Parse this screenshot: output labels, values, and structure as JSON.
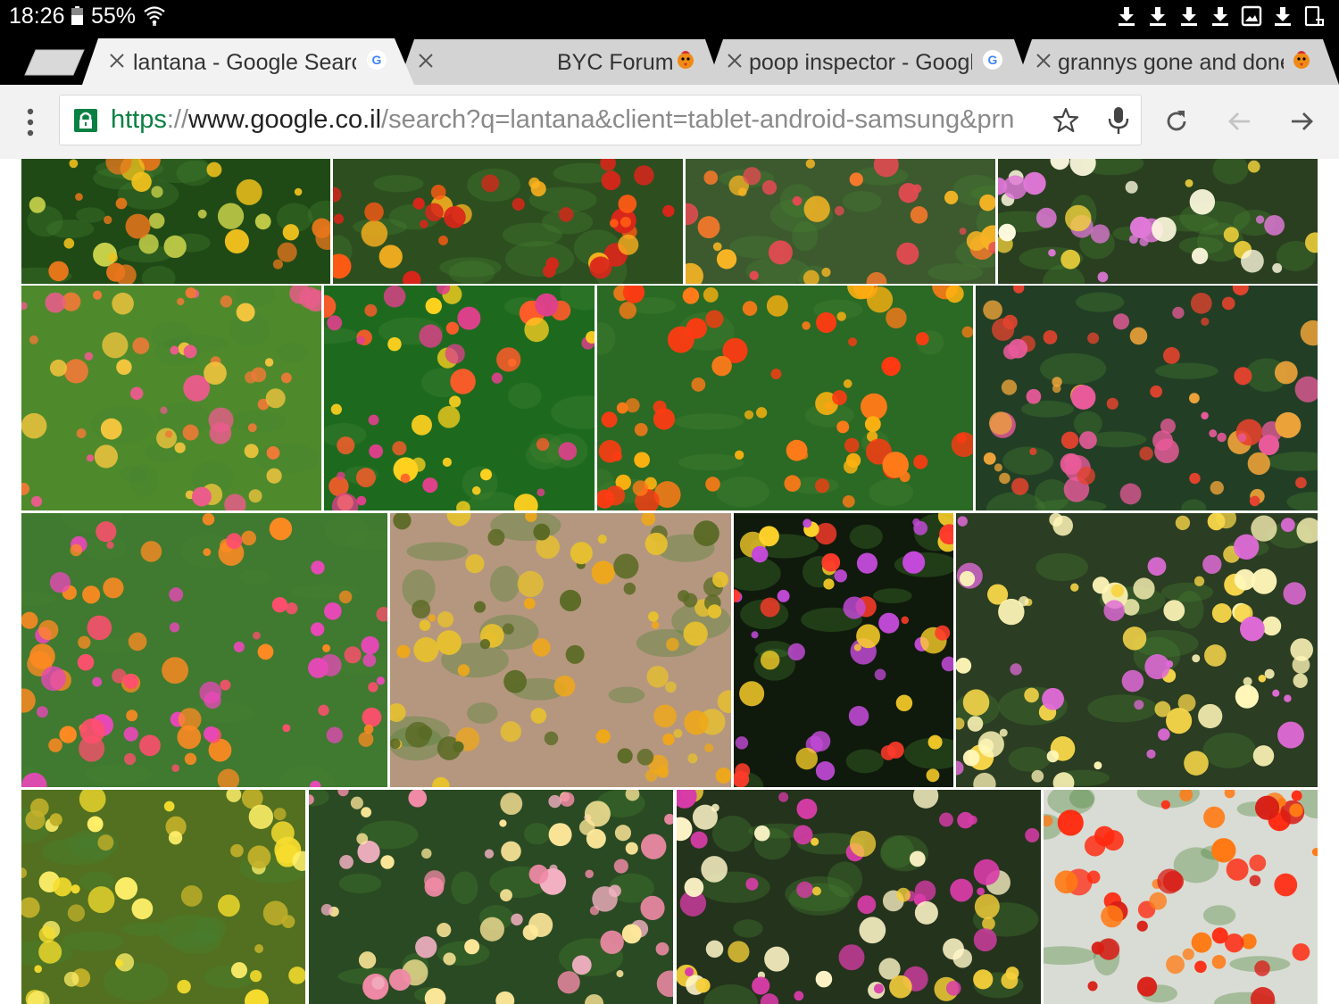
{
  "status_bar": {
    "time": "18:26",
    "battery": "55%",
    "icons": [
      "battery-icon",
      "wifi-icon",
      "download-icon",
      "download-icon",
      "download-icon",
      "download-icon",
      "image-icon",
      "download-icon",
      "screen-icon"
    ]
  },
  "tabs": [
    {
      "title": "lantana - Google Searc",
      "favicon": "google-icon",
      "active": true
    },
    {
      "title": "BYC Forum",
      "favicon": "chicken-icon",
      "active": false
    },
    {
      "title": "poop inspector - Googl",
      "favicon": "google-icon",
      "active": false
    },
    {
      "title": "grannys gone and done",
      "favicon": "chicken-icon",
      "active": false
    }
  ],
  "omnibox": {
    "scheme": "https",
    "separator": "://",
    "host": "www.google.co.il",
    "path": "/search?q=lantana&client=tablet-android-samsung&prn"
  },
  "colors": {
    "secure": "#0b8043",
    "toolbar": "#f2f2f2",
    "tab_active": "#f2f2f2",
    "tab_inactive": "#d3d3d3"
  },
  "image_results": [
    {
      "name": "lantana-yellow-orange-closeup",
      "palette": [
        "#1f4a16",
        "#f2c21d",
        "#e8761b",
        "#c9d24a"
      ]
    },
    {
      "name": "lantana-orange-red-bed",
      "palette": [
        "#2d4f1f",
        "#ff5a14",
        "#ffb21e",
        "#d8261a"
      ]
    },
    {
      "name": "lantana-orange-bush",
      "palette": [
        "#3c5a2e",
        "#f6b425",
        "#ff7a2b",
        "#e64a52"
      ]
    },
    {
      "name": "lantana-pink-white",
      "palette": [
        "#2a3f20",
        "#e078d8",
        "#fffbe0",
        "#f2d23c"
      ]
    },
    {
      "name": "lantana-pink-yellow-field",
      "palette": [
        "#4e8a2c",
        "#ea5c8c",
        "#f4c53d",
        "#ee7a36"
      ]
    },
    {
      "name": "lantana-yellow-red-green",
      "palette": [
        "#1d6a1f",
        "#ffd11f",
        "#ff5b2b",
        "#e0408c"
      ]
    },
    {
      "name": "lantana-orange-red-mass",
      "palette": [
        "#2a6a24",
        "#ff3a12",
        "#ffb210",
        "#ff7a18"
      ]
    },
    {
      "name": "lantana-ground-cover",
      "palette": [
        "#223f25",
        "#e4432e",
        "#f0a43a",
        "#e85a9a"
      ]
    },
    {
      "name": "lantana-multicolor-bed",
      "palette": [
        "#3f7a30",
        "#ff4f6e",
        "#ff8a22",
        "#e848b8"
      ]
    },
    {
      "name": "lantana-gravel-shrub",
      "palette": [
        "#b5977f",
        "#f0a818",
        "#5a6a24",
        "#e7c12e"
      ]
    },
    {
      "name": "lantana-varieties-collage",
      "palette": [
        "#0f1a0c",
        "#c34ad8",
        "#ffd22a",
        "#ff3b2a"
      ]
    },
    {
      "name": "lantana-pink-yellow-closeup",
      "palette": [
        "#2b3d22",
        "#e06ad8",
        "#fff6b8",
        "#f7d64a"
      ]
    },
    {
      "name": "lantana-yellow-field",
      "palette": [
        "#52701f",
        "#f6dd2e",
        "#ffef6a",
        "#c2b02a"
      ]
    },
    {
      "name": "lantana-pink-pastel",
      "palette": [
        "#2a4a23",
        "#f08aa6",
        "#ffe89a",
        "#f2b0c2"
      ]
    },
    {
      "name": "lantana-pink-white-dome",
      "palette": [
        "#24331c",
        "#d83ca8",
        "#fff6c8",
        "#f6d03a"
      ]
    },
    {
      "name": "lantana-red-orange-closeup",
      "palette": [
        "#d9dcd4",
        "#ff2a10",
        "#ff7a14",
        "#d81e16"
      ]
    }
  ]
}
